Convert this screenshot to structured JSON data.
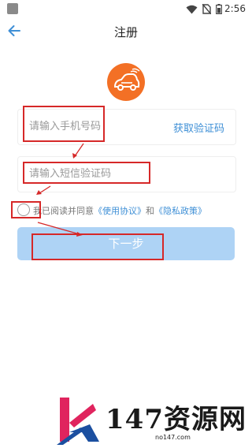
{
  "status_bar": {
    "time": "2:56"
  },
  "header": {
    "title": "注册"
  },
  "form": {
    "phone_placeholder": "请输入手机号码",
    "get_code_label": "获取验证码",
    "code_placeholder": "请输入短信验证码"
  },
  "agreement": {
    "text": "我已阅读并同意",
    "terms_link": "《使用协议》",
    "and": "和",
    "privacy_link": "《隐私政策》"
  },
  "next_button_label": "下一步",
  "watermark": {
    "brand": "147资源网",
    "url": "no147.com"
  },
  "colors": {
    "accent": "#3e8fd6",
    "button_disabled": "#aed3f5",
    "logo_orange": "#f37025",
    "annotation_red": "#d62828"
  },
  "icons": [
    "back-arrow-icon",
    "wifi-icon",
    "no-sim-icon",
    "battery-icon",
    "car-logo-icon"
  ]
}
